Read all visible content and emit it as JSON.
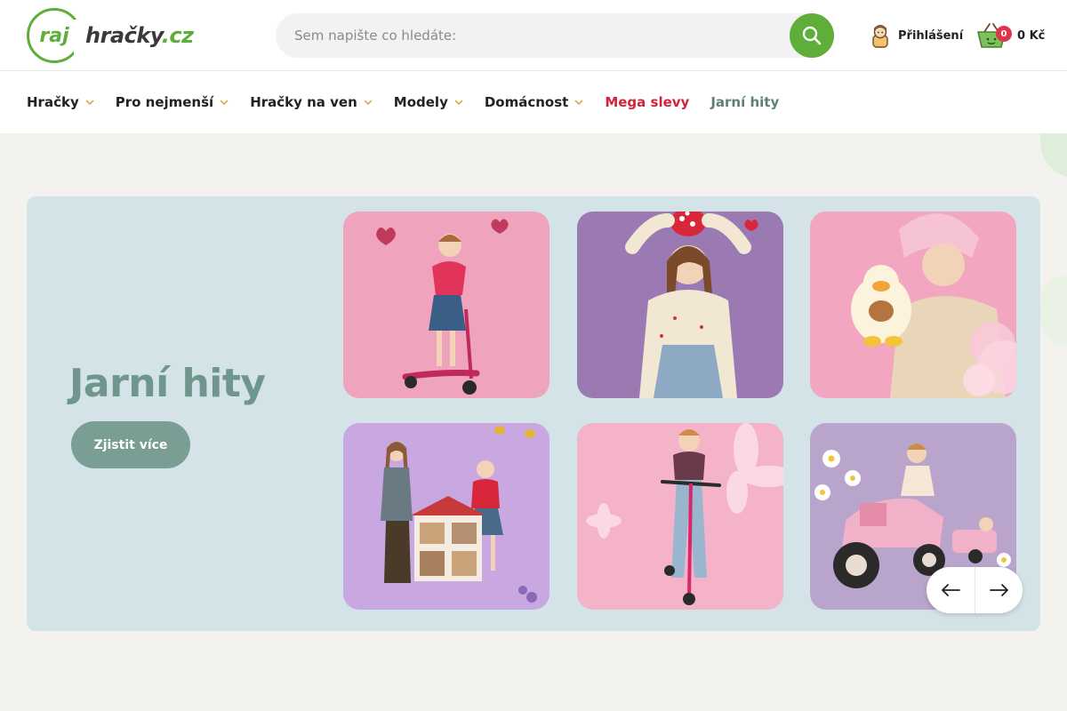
{
  "header": {
    "logo": {
      "part1": "raj",
      "part2": "hračky",
      "part3": ".cz"
    },
    "search": {
      "placeholder": "Sem napište co hledáte:",
      "button_icon": "search-icon"
    },
    "login": {
      "label": "Přihlášení",
      "icon": "user-avatar-icon"
    },
    "cart": {
      "count": "0",
      "total": "0 Kč",
      "icon": "basket-icon"
    }
  },
  "nav": {
    "items": [
      {
        "label": "Hračky",
        "has_dropdown": true
      },
      {
        "label": "Pro nejmenší",
        "has_dropdown": true
      },
      {
        "label": "Hračky na ven",
        "has_dropdown": true
      },
      {
        "label": "Modely",
        "has_dropdown": true
      },
      {
        "label": "Domácnost",
        "has_dropdown": true
      },
      {
        "label": "Mega slevy",
        "has_dropdown": false
      },
      {
        "label": "Jarní hity",
        "has_dropdown": false
      }
    ]
  },
  "hero": {
    "title": "Jarní hity",
    "cta_label": "Zjistit více",
    "tiles": [
      {
        "subject": "girl on pink scooter with hearts",
        "bg": "#f0a3bd"
      },
      {
        "subject": "girl holding ladybird plush",
        "bg": "#9b79b3"
      },
      {
        "subject": "girl with duck-costume plush",
        "bg": "#f2a6c0"
      },
      {
        "subject": "two girls with dollhouse",
        "bg": "#c9a7e0"
      },
      {
        "subject": "girl on pink kick scooter with flowers",
        "bg": "#f4b3c9"
      },
      {
        "subject": "girl on pink pedal tractor",
        "bg": "#b9a4cc"
      }
    ],
    "prev_icon": "arrow-left-icon",
    "next_icon": "arrow-right-icon"
  },
  "colors": {
    "brand_green": "#5fae3a",
    "sale_red": "#d2233b",
    "spring_teal": "#5d8178",
    "hero_bg": "#d4e3e8",
    "cta_bg": "#7a9d94"
  }
}
